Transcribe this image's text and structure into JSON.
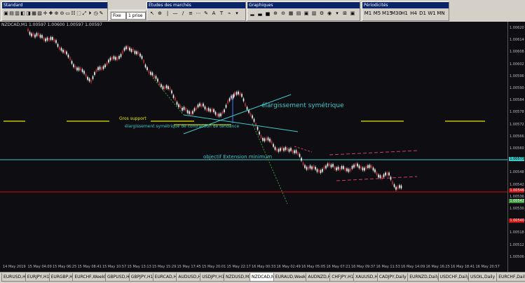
{
  "toolbars": {
    "standard": {
      "title": "Standard",
      "buttons": [
        "▣",
        "▤",
        "▥",
        "◧",
        "◨",
        "▦",
        "▧",
        "✛",
        "✚",
        "⊕",
        "⊖",
        "▭",
        "☷",
        "⬚",
        "⤢",
        "⏵",
        "◷",
        "✎"
      ]
    },
    "timeframe": {
      "combo": "Fixe",
      "combo2": "1 prise"
    },
    "drawing": {
      "title": "Études des marchés",
      "buttons": [
        "↖",
        "⊕",
        "|",
        "—",
        "/",
        "≡",
        "⋯",
        "✎",
        "A",
        "T",
        "⌁",
        "▾"
      ]
    },
    "graphics": {
      "title": "Graphiques",
      "buttons": [
        "▂",
        "▃",
        "▅",
        "⊕",
        "⊖",
        "▦",
        "▤",
        "▣",
        "▥",
        "⚙",
        "◉",
        "▾",
        "⊞",
        "▣"
      ]
    },
    "periods": {
      "title": "Périodicités",
      "buttons": [
        "M1",
        "M5",
        "M15",
        "M30",
        "H1",
        "H4",
        "D1",
        "W1",
        "MN"
      ]
    }
  },
  "chart": {
    "header": "NZDCAD,M1  1.00597 1.00600 1.00597 1.00597",
    "annotations": {
      "symmetric_widening": "élargissement symétrique",
      "green_support": "Gros support",
      "contraction": "élargissement symétrique de contraction de tendance",
      "channel": "objectif Extension minimum"
    },
    "price_ticks": [
      "1.00620",
      "1.00614",
      "1.00608",
      "1.00602",
      "1.00596",
      "1.00590",
      "1.00584",
      "1.00578",
      "1.00572",
      "1.00566",
      "1.00560",
      "1.00554",
      "1.00548",
      "1.00542",
      "1.00536",
      "1.00530",
      "1.00524",
      "1.00518",
      "1.00512",
      "1.00506"
    ],
    "price_labels": {
      "cyan": "1.00573",
      "red": "1.00546",
      "green": "1.00542",
      "red_box": "1.00540"
    },
    "time_ticks": [
      "14 May 2019",
      "15 May 04:09",
      "15 May 06:25",
      "15 May 08:41",
      "15 May 10:57",
      "15 May 13:13",
      "15 May 15:29",
      "15 May 17:45",
      "15 May 20:01",
      "15 May 22:17",
      "16 May 00:33",
      "16 May 02:49",
      "16 May 05:05",
      "16 May 07:21",
      "16 May 09:37",
      "16 May 11:53",
      "16 May 14:09",
      "16 May 16:25",
      "16 May 18:41",
      "16 May 20:57"
    ]
  },
  "tabs": [
    "EURUSD,H1",
    "EURJPY,H1",
    "EURGBP,H1",
    "EURCHF,Weekly",
    "GBPUSD,H1",
    "GBPJPY,H1",
    "EURCAD,H1",
    "AUDUSD,H1",
    "USDJPY,H1",
    "NZDUSD,M30",
    "NZDCAD,M1",
    "EURAUD,Weekly",
    "AUDNZD,H1",
    "CHFJPY,H1",
    "XAUUSD,H1",
    "CADJPY,Daily",
    "EURNZD,Daily",
    "USDCHF,Daily",
    "USOIL,Daily",
    "EURCHF,Daily"
  ],
  "active_tab": 10,
  "colors": {
    "cyan": "#40c8c8",
    "red": "#cc1010",
    "yellow": "#e8e800",
    "green": "#3c9a3c",
    "bull": "#ffffff",
    "bear": "#ffffff",
    "red_dash": "#d04060"
  }
}
